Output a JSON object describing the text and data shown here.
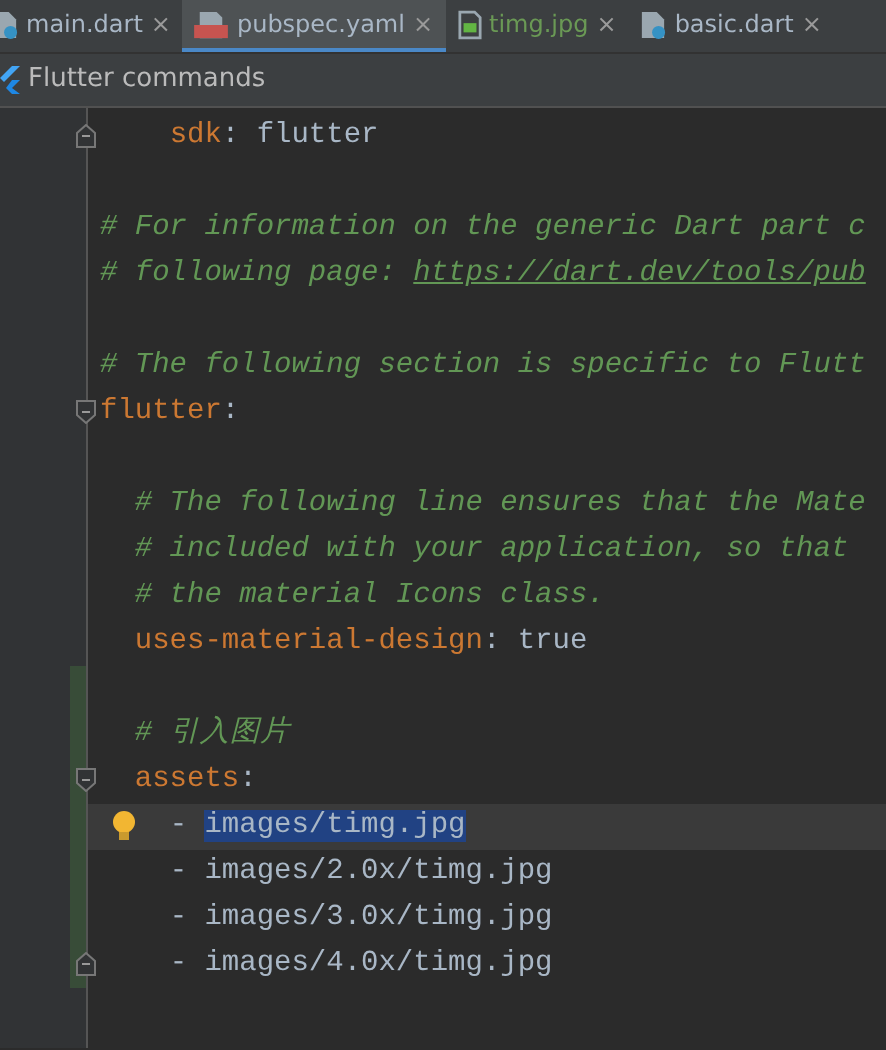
{
  "tabs": [
    {
      "label": "main.dart",
      "kind": "dart",
      "selected": false,
      "close": "×"
    },
    {
      "label": "pubspec.yaml",
      "kind": "yaml",
      "selected": true,
      "close": "×"
    },
    {
      "label": "timg.jpg",
      "kind": "image",
      "selected": false,
      "close": "×"
    },
    {
      "label": "basic.dart",
      "kind": "dart",
      "selected": false,
      "close": "×"
    }
  ],
  "toolbar": {
    "title": "Flutter commands"
  },
  "lines": [
    {
      "kind": "fold-end",
      "segments": [
        {
          "text": "    sdk",
          "kind": "key"
        },
        {
          "text": ": flutter",
          "kind": "value"
        }
      ],
      "changed": false,
      "current": false
    },
    {
      "kind": "plain",
      "changed": false,
      "current": false
    },
    {
      "kind": "plain",
      "segments": [
        {
          "text": "# For information on the generic Dart part c",
          "kind": "comment"
        }
      ],
      "changed": false,
      "current": false
    },
    {
      "kind": "plain",
      "segments": [
        {
          "text": "# following page: ",
          "kind": "comment"
        },
        {
          "text": "https://dart.dev/tools/pub",
          "kind": "link"
        }
      ],
      "changed": false,
      "current": false
    },
    {
      "kind": "plain",
      "changed": false,
      "current": false
    },
    {
      "kind": "plain",
      "segments": [
        {
          "text": "# The following section is specific to Flutt",
          "kind": "comment"
        }
      ],
      "changed": false,
      "current": false
    },
    {
      "kind": "fold-start",
      "segments": [
        {
          "text": "flutter",
          "kind": "key"
        },
        {
          "text": ":",
          "kind": "value"
        }
      ],
      "changed": false,
      "current": false
    },
    {
      "kind": "plain",
      "changed": false,
      "current": false
    },
    {
      "kind": "plain",
      "segments": [
        {
          "text": "  # The following line ensures that the Mate",
          "kind": "comment"
        }
      ],
      "changed": false,
      "current": false
    },
    {
      "kind": "plain",
      "segments": [
        {
          "text": "  # included with your application, so that",
          "kind": "comment"
        }
      ],
      "changed": false,
      "current": false
    },
    {
      "kind": "plain",
      "segments": [
        {
          "text": "  # the material Icons class.",
          "kind": "comment"
        }
      ],
      "changed": false,
      "current": false
    },
    {
      "kind": "plain",
      "segments": [
        {
          "text": "  uses-material-design",
          "kind": "key"
        },
        {
          "text": ": true",
          "kind": "value"
        }
      ],
      "changed": false,
      "current": false
    },
    {
      "kind": "plain",
      "changed": true,
      "current": false
    },
    {
      "kind": "plain",
      "segments": [
        {
          "text": "  # 引入图片",
          "kind": "comment"
        }
      ],
      "changed": true,
      "current": false
    },
    {
      "kind": "fold-start",
      "segments": [
        {
          "text": "  assets",
          "kind": "key"
        },
        {
          "text": ":",
          "kind": "value"
        }
      ],
      "changed": true,
      "current": false
    },
    {
      "kind": "plain",
      "segments": [
        {
          "text": "    - ",
          "kind": "value",
          "selected": false
        },
        {
          "text": "images/timg.jpg",
          "kind": "value",
          "selected": true
        }
      ],
      "bulb": true,
      "changed": true,
      "current": true
    },
    {
      "kind": "plain",
      "segments": [
        {
          "text": "    - images/2.0x/timg.jpg",
          "kind": "value"
        }
      ],
      "changed": true,
      "current": false
    },
    {
      "kind": "plain",
      "segments": [
        {
          "text": "    - images/3.0x/timg.jpg",
          "kind": "value"
        }
      ],
      "changed": true,
      "current": false
    },
    {
      "kind": "fold-end",
      "segments": [
        {
          "text": "    - images/4.0x/timg.jpg",
          "kind": "value"
        }
      ],
      "changed": true,
      "current": false
    },
    {
      "kind": "plain",
      "changed": false,
      "current": false
    }
  ]
}
